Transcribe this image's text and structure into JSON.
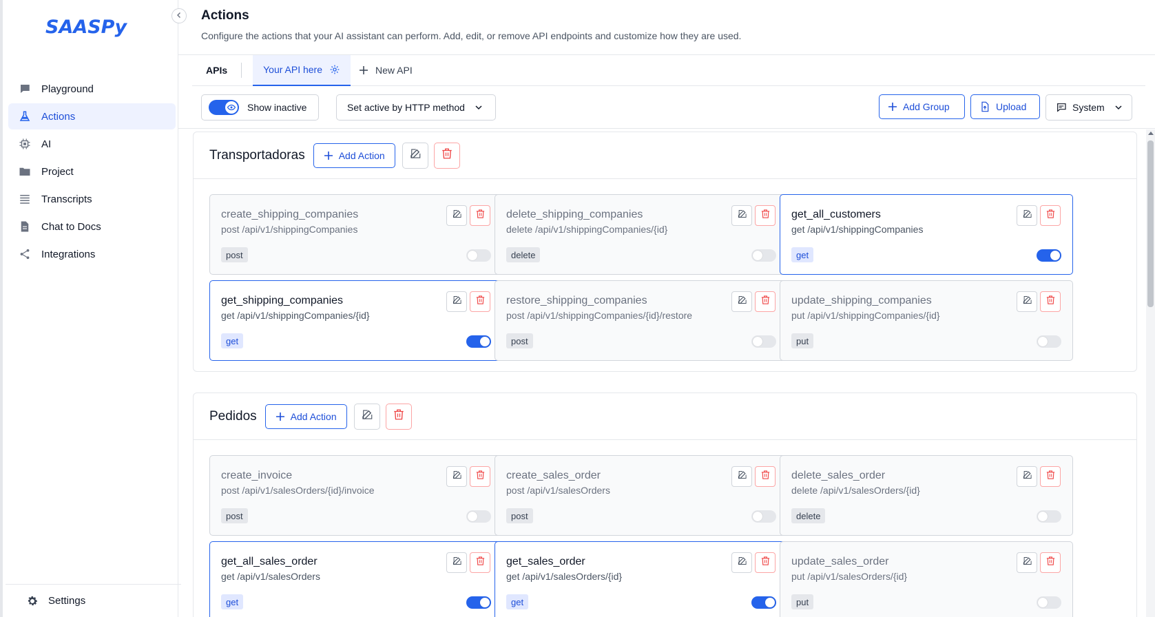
{
  "sidebar": {
    "logo_text": "SAASPy",
    "items": [
      {
        "label": "Playground",
        "icon": "chat-bubble-icon",
        "active": false
      },
      {
        "label": "Actions",
        "icon": "flask-icon",
        "active": true
      },
      {
        "label": "AI",
        "icon": "chip-icon",
        "active": false
      },
      {
        "label": "Project",
        "icon": "folder-icon",
        "active": false
      },
      {
        "label": "Transcripts",
        "icon": "list-icon",
        "active": false
      },
      {
        "label": "Chat to Docs",
        "icon": "document-icon",
        "active": false
      },
      {
        "label": "Integrations",
        "icon": "share-icon",
        "active": false
      }
    ],
    "settings_label": "Settings"
  },
  "header": {
    "title": "Actions",
    "description": "Configure the actions that your AI assistant can perform. Add, edit, or remove API endpoints and customize how they are used."
  },
  "tabs": {
    "apis_label": "APIs",
    "active_tab": "Your API here",
    "new_api": "New API"
  },
  "toolbar": {
    "show_inactive_label": "Show inactive",
    "set_active_label": "Set active by HTTP method",
    "add_group_label": "Add Group",
    "upload_label": "Upload",
    "system_label": "System"
  },
  "colors": {
    "accent": "#2563eb",
    "danger": "#ef4444"
  },
  "groups": [
    {
      "title": "Transportadoras",
      "add_action_label": "Add Action",
      "actions": [
        {
          "name": "create_shipping_companies",
          "path": "post /api/v1/shippingCompanies",
          "method": "post",
          "active": false
        },
        {
          "name": "delete_shipping_companies",
          "path": "delete /api/v1/shippingCompanies/{id}",
          "method": "delete",
          "active": false
        },
        {
          "name": "get_all_customers",
          "path": "get /api/v1/shippingCompanies",
          "method": "get",
          "active": true
        },
        {
          "name": "get_shipping_companies",
          "path": "get /api/v1/shippingCompanies/{id}",
          "method": "get",
          "active": true
        },
        {
          "name": "restore_shipping_companies",
          "path": "post /api/v1/shippingCompanies/{id}/restore",
          "method": "post",
          "active": false
        },
        {
          "name": "update_shipping_companies",
          "path": "put /api/v1/shippingCompanies/{id}",
          "method": "put",
          "active": false
        }
      ]
    },
    {
      "title": "Pedidos",
      "add_action_label": "Add Action",
      "actions": [
        {
          "name": "create_invoice",
          "path": "post /api/v1/salesOrders/{id}/invoice",
          "method": "post",
          "active": false
        },
        {
          "name": "create_sales_order",
          "path": "post /api/v1/salesOrders",
          "method": "post",
          "active": false
        },
        {
          "name": "delete_sales_order",
          "path": "delete /api/v1/salesOrders/{id}",
          "method": "delete",
          "active": false
        },
        {
          "name": "get_all_sales_order",
          "path": "get /api/v1/salesOrders",
          "method": "get",
          "active": true
        },
        {
          "name": "get_sales_order",
          "path": "get /api/v1/salesOrders/{id}",
          "method": "get",
          "active": true
        },
        {
          "name": "update_sales_order",
          "path": "put /api/v1/salesOrders/{id}",
          "method": "put",
          "active": false
        }
      ]
    }
  ]
}
